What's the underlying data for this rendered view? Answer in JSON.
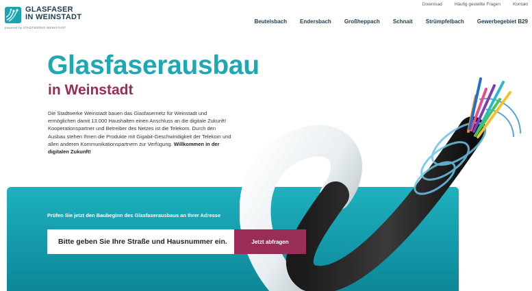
{
  "utility_nav": [
    "Download",
    "Häufig gestellte Fragen",
    "Kontakt"
  ],
  "logo": {
    "line1": "GLASFASER",
    "line2": "IN WEINSTADT",
    "powered": "powered by STADTWERKE WEINSTADT",
    "brand_color": "#1aa3b4"
  },
  "main_nav": [
    "Beutelsbach",
    "Endersbach",
    "Großheppach",
    "Schnait",
    "Strümpfelbach",
    "Gewerbegebiet B29"
  ],
  "hero": {
    "title": "Glasfaserausbau",
    "subtitle": "in Weinstadt",
    "intro": "Die Stadtwerke Weinstadt bauen das Glasfasernetz für Weinstadt und ermöglichen damit 13.000 Haushalten einen Anschluss an die digitale Zukunft! Kooperationspartner und Betreiber des Netzes ist die Telekom. Durch den Ausbau stehen Ihnen die Produkte mit Gigabit-Geschwindigkeit der Telekom und allen anderen Kommunikationspartnern zur Verfügung.",
    "intro_bold": "Willkommen in der digitalen Zukunft!",
    "title_color": "#1fa8b3",
    "subtitle_color": "#9b2c58"
  },
  "check": {
    "label": "Prüfen Sie jetzt den Baubeginn des Glasfaserausbaus an Ihrer Adresse",
    "placeholder": "Bitte geben Sie Ihre Straße und Hausnummer ein.",
    "button": "Jetzt abfragen",
    "band_color": "#149aaa",
    "button_color": "#9a2c58"
  }
}
